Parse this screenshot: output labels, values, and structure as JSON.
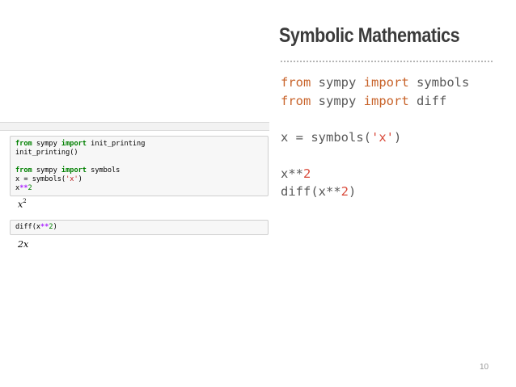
{
  "notebook": {
    "cell1": {
      "line1": {
        "kw1": "from",
        "mid": " sympy ",
        "kw2": "import",
        "rest": " init_printing"
      },
      "line2": "init_printing()",
      "line3": {
        "kw1": "from",
        "mid": " sympy ",
        "kw2": "import",
        "rest": " symbols"
      },
      "line4": {
        "pre": "x = symbols(",
        "str": "'x'",
        "post": ")"
      },
      "line5": {
        "pre": "x",
        "op": "**",
        "num": "2"
      }
    },
    "output1": {
      "base": "x",
      "exp": "2"
    },
    "cell2": {
      "pre": "diff(x",
      "op": "**",
      "num": "2",
      "post": ")"
    },
    "output2": "2x"
  },
  "slide": {
    "title": "Symbolic Mathematics",
    "code": {
      "line1": {
        "kw1": "from",
        "mid": " sympy ",
        "kw2": "import",
        "rest": " symbols"
      },
      "line2": {
        "kw1": "from",
        "mid": " sympy ",
        "kw2": "import",
        "rest": " diff"
      },
      "line4": {
        "pre": "x = symbols(",
        "str": "'x'",
        "post": ")"
      },
      "line6": {
        "pre": "x**",
        "num": "2"
      },
      "line7": {
        "pre": "diff(x**",
        "num": "2",
        "post": ")"
      }
    },
    "page_number": "10"
  }
}
